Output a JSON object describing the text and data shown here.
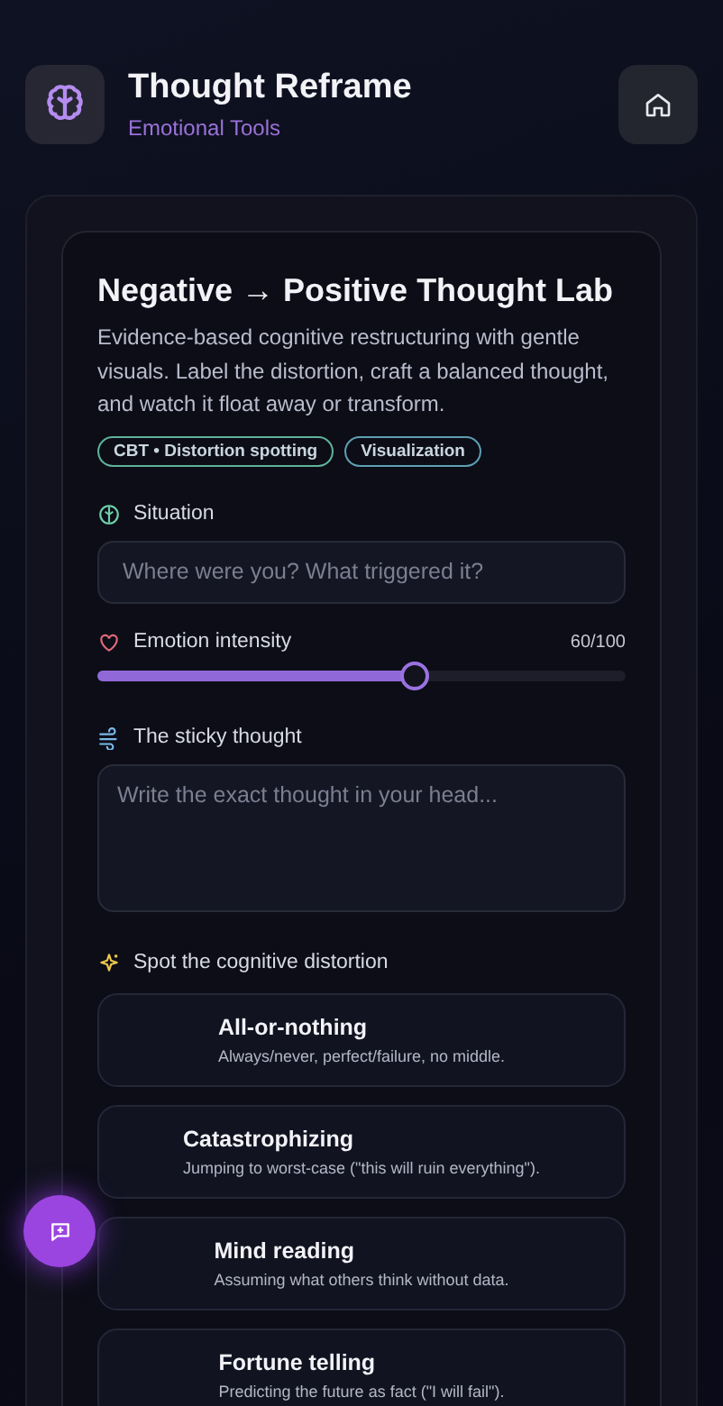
{
  "header": {
    "title": "Thought Reframe",
    "subtitle": "Emotional Tools"
  },
  "lab": {
    "title": "Negative → Positive Thought Lab",
    "description": "Evidence-based cognitive restructuring with gentle visuals. Label the distortion, craft a balanced thought, and watch it float away or transform.",
    "tags": [
      {
        "label": "CBT • Distortion spotting",
        "color": "#5fb39a"
      },
      {
        "label": "Visualization",
        "color": "#5f9fb3"
      }
    ]
  },
  "situation": {
    "label": "Situation",
    "placeholder": "Where were you? What triggered it?"
  },
  "intensity": {
    "label": "Emotion intensity",
    "reading": "60/100",
    "level": 0.6
  },
  "thought": {
    "label": "The sticky thought",
    "placeholder": "Write the exact thought in your head..."
  },
  "distortions": {
    "label": "Spot the cognitive distortion",
    "items": [
      {
        "name": "All-or-nothing",
        "description": "Always/never, perfect/failure, no middle."
      },
      {
        "name": "Catastrophizing",
        "description": "Jumping to worst-case (\"this will ruin everything\")."
      },
      {
        "name": "Mind reading",
        "description": "Assuming what others think without data."
      },
      {
        "name": "Fortune telling",
        "description": "Predicting the future as fact (\"I will fail\")."
      }
    ]
  }
}
